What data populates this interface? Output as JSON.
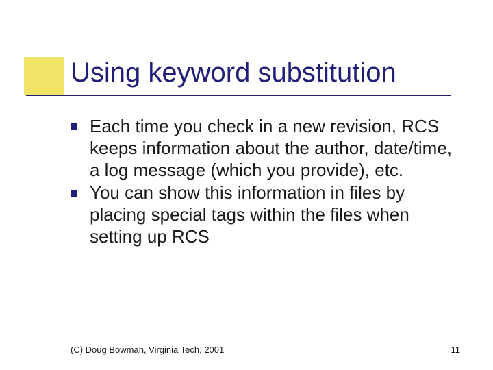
{
  "title": "Using keyword substitution",
  "bullets": [
    "Each time you check in a new revision, RCS keeps information about the author, date/time, a log message (which you provide), etc.",
    "You can show this information in files by placing special tags within the files when setting up RCS"
  ],
  "footer": {
    "copyright": "(C) Doug Bowman, Virginia Tech, 2001",
    "page": "11"
  },
  "colors": {
    "accent_yellow": "#e8d000",
    "accent_blue": "#1f1f7a"
  }
}
